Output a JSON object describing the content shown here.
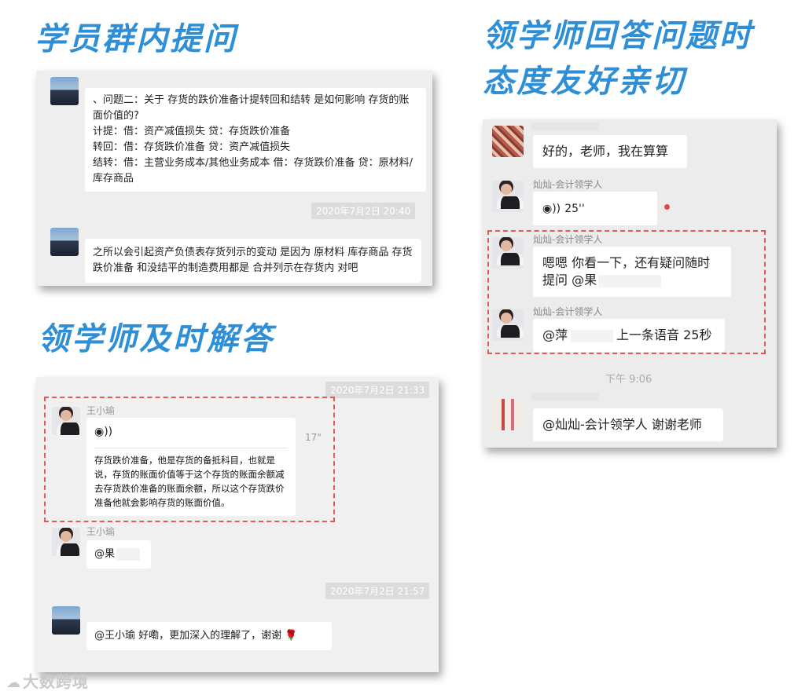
{
  "headings": {
    "top_left": "学员群内提问",
    "right_line1": "领学师回答问题时",
    "right_line2": "态度友好亲切",
    "mid_left": "领学师及时解答"
  },
  "panel1": {
    "question_lines": [
      "、问题二：关于 存货的跌价准备计提转回和结转 是如何影响 存货的账面价值的?",
      "计提：借：资产减值损失  贷：存货跌价准备",
      "转回：借：存货跌价准备  贷：资产减值损失",
      "结转：借：主营业务成本/其他业务成本  借：存货跌价准备   贷：原材料/库存商品"
    ],
    "timestamp": "2020年7月2日 20:40",
    "followup": "之所以会引起资产负债表存货列示的变动 是因为  原材料 库存商品 存货跌价准备 和没结平的制造费用都是 合并列示在存货内 对吧"
  },
  "panel2": {
    "timestamp1": "2020年7月2日 21:33",
    "sender1": "王小瑜",
    "voice_duration": "17\"",
    "voice_icon": "voice-icon",
    "voice_text": "存货跌价准备，他是存货的备抵科目，也就是说，存货的账面价值等于这个存货的账面余额减去存货跌价准备的账面余额，所以这个存货跌价准备他就会影响存货的账面价值。",
    "sender2": "王小瑜",
    "mention": "@果",
    "timestamp2": "2020年7月2日 21:57",
    "reply": "@王小瑜 好嘞，更加深入的理解了，谢谢",
    "emoji": "🌹"
  },
  "panel3": {
    "msg1": "好的，老师，我在算算",
    "sender_a": "灿灿-会计领学人",
    "voice_len": "25''",
    "sender_b": "灿灿-会计领学人",
    "msg_b": "嗯嗯 你看一下，还有疑问随时提问 @果",
    "sender_c": "灿灿-会计领学人",
    "msg_c_prefix": "@萍",
    "msg_c_suffix": "上一条语音 25秒",
    "time_plain": "下午 9:06",
    "msg_last": "@灿灿-会计领学人 谢谢老师"
  },
  "watermark": "大数跨境"
}
